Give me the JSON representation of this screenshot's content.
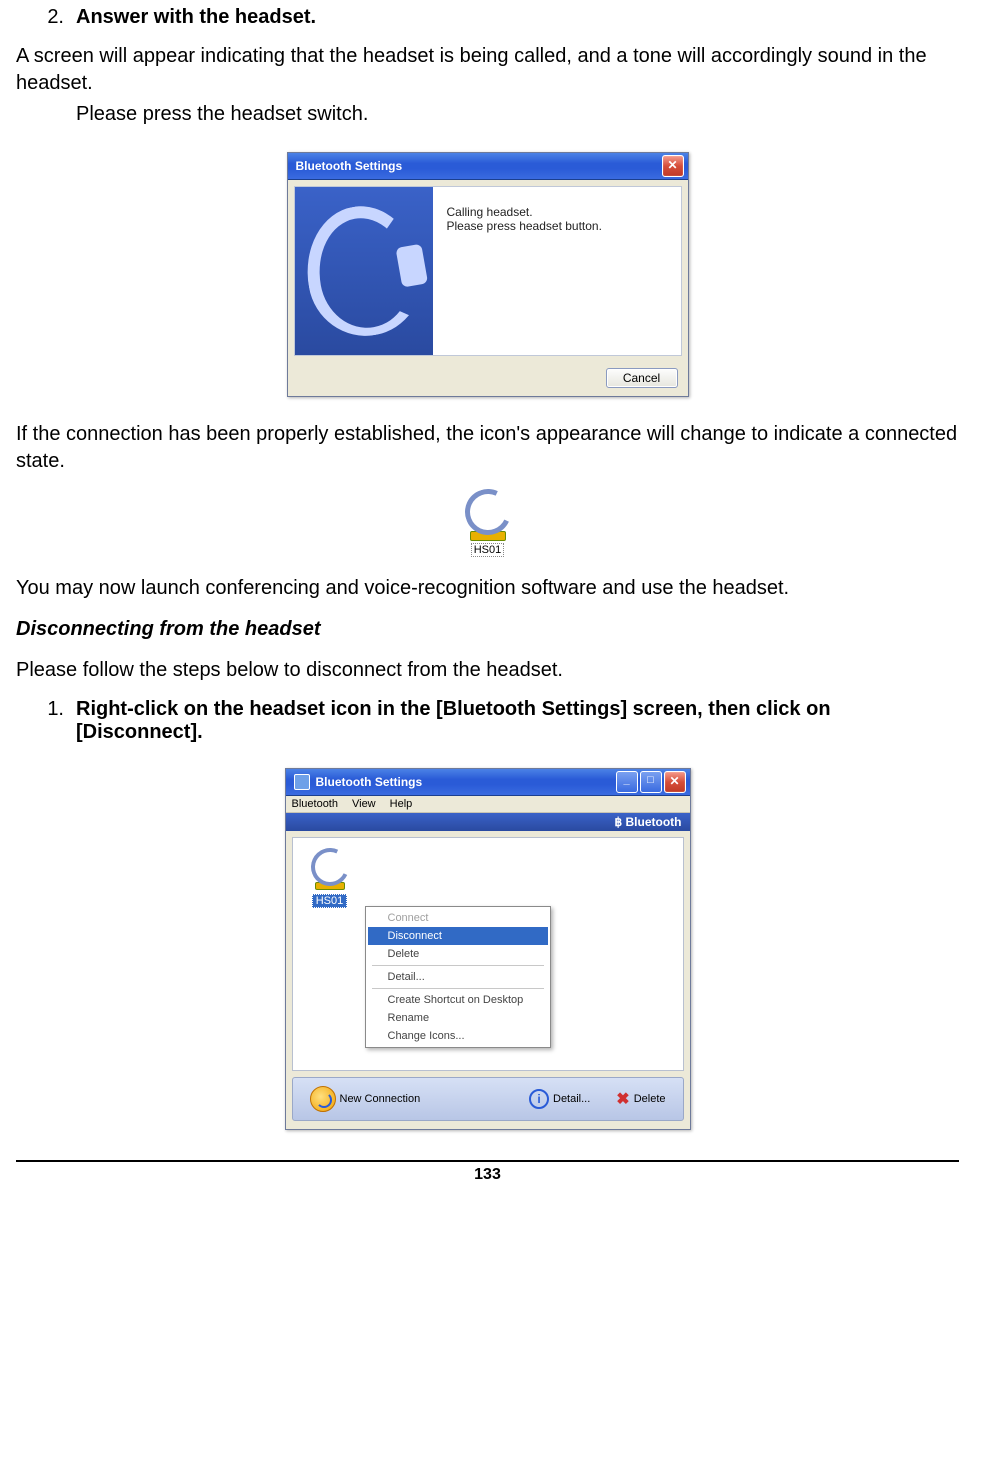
{
  "step2": {
    "num": "2.",
    "title": "Answer with the headset.",
    "line1": "A screen will appear indicating that the headset is being called, and a tone will accordingly sound in the headset.",
    "line2": "Please press the headset switch."
  },
  "dialog1": {
    "title": "Bluetooth Settings",
    "msg1": "Calling headset.",
    "msg2": "Please press headset button.",
    "cancel": "Cancel"
  },
  "after_dialog": "If the connection has been properly established, the icon's appearance will change to indicate a connected state.",
  "connected_icon_label": "HS01",
  "after_icon": "You may now launch conferencing and voice-recognition software and use the headset.",
  "section_heading": "Disconnecting from the headset",
  "section_intro": "Please follow the steps below to disconnect from the headset.",
  "step1": {
    "num": "1.",
    "title": "Right-click on the headset icon in the [Bluetooth Settings] screen, then click on [Disconnect]."
  },
  "window2": {
    "title": "Bluetooth Settings",
    "menu": {
      "bluetooth": "Bluetooth",
      "view": "View",
      "help": "Help"
    },
    "brand": "Bluetooth",
    "device_label": "HS01",
    "context": {
      "connect": "Connect",
      "disconnect": "Disconnect",
      "delete": "Delete",
      "detail": "Detail...",
      "shortcut": "Create Shortcut on Desktop",
      "rename": "Rename",
      "change_icons": "Change Icons..."
    },
    "actions": {
      "new_connection": "New Connection",
      "detail": "Detail...",
      "delete": "Delete"
    }
  },
  "page_number": "133",
  "bt_glyph": "฿"
}
